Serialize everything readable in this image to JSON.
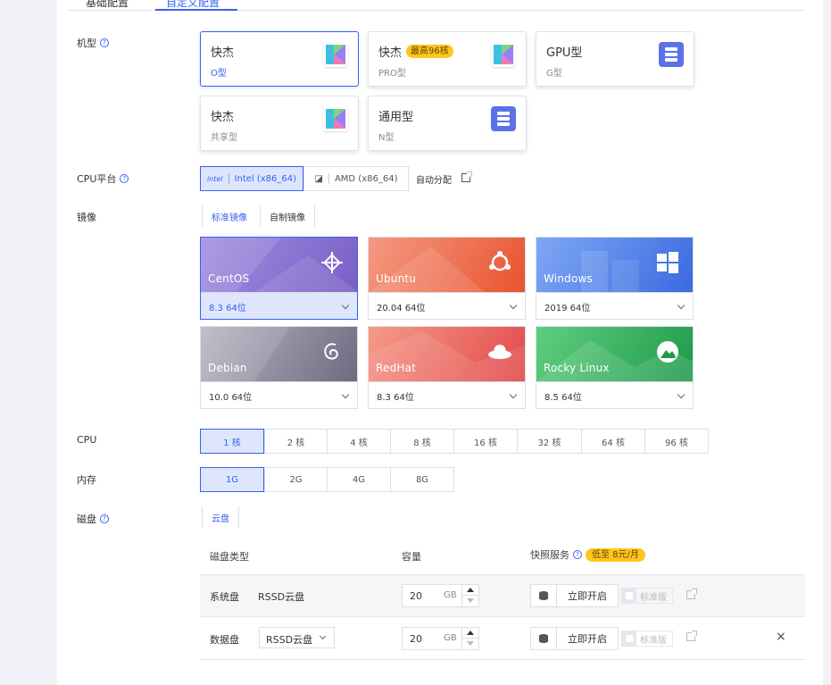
{
  "top_tabs": [
    "基础配置",
    "自定义配置"
  ],
  "model": {
    "label": "机型",
    "cards": [
      {
        "title": "快杰",
        "sub": "O型",
        "badge": "",
        "icon": "kuaijie-icon"
      },
      {
        "title": "快杰",
        "sub": "PRO型",
        "badge": "最高96核",
        "icon": "kuaijie-icon"
      },
      {
        "title": "GPU型",
        "sub": "G型",
        "badge": "",
        "icon": "server-icon"
      },
      {
        "title": "快杰",
        "sub": "共享型",
        "badge": "",
        "icon": "kuaijie-icon"
      },
      {
        "title": "通用型",
        "sub": "N型",
        "badge": "",
        "icon": "server-icon"
      }
    ]
  },
  "cpu_platform": {
    "label": "CPU平台",
    "options": [
      "Intel (x86_64)",
      "AMD (x86_64)"
    ],
    "auto": "自动分配"
  },
  "image": {
    "label": "镜像",
    "tabs": [
      "标准镜像",
      "自制镜像"
    ],
    "os": [
      {
        "name": "CentOS",
        "version": "8.3 64位"
      },
      {
        "name": "Ubuntu",
        "version": "20.04 64位"
      },
      {
        "name": "Windows",
        "version": "2019 64位"
      },
      {
        "name": "Debian",
        "version": "10.0 64位"
      },
      {
        "name": "RedHat",
        "version": "8.3 64位"
      },
      {
        "name": "Rocky Linux",
        "version": "8.5 64位"
      }
    ]
  },
  "cpu": {
    "label": "CPU",
    "options": [
      "1 核",
      "2 核",
      "4 核",
      "8 核",
      "16 核",
      "32 核",
      "64 核",
      "96 核"
    ],
    "selected": "1 核"
  },
  "memory": {
    "label": "内存",
    "options": [
      "1G",
      "2G",
      "4G",
      "8G"
    ],
    "selected": "1G"
  },
  "disk": {
    "label": "磁盘",
    "tab": "云盘",
    "headers": {
      "type": "磁盘类型",
      "capacity": "容量",
      "snapshot": "快照服务"
    },
    "snapshot_badge": "低至 8元/月",
    "rows": [
      {
        "kind": "系统盘",
        "type": "RSSD云盘",
        "size": "20",
        "unit": "GB",
        "enable": "立即开启",
        "edition": "标准版"
      },
      {
        "kind": "数据盘",
        "type": "RSSD云盘",
        "size": "20",
        "unit": "GB",
        "enable": "立即开启",
        "edition": "标准版",
        "remove": "×"
      }
    ]
  }
}
